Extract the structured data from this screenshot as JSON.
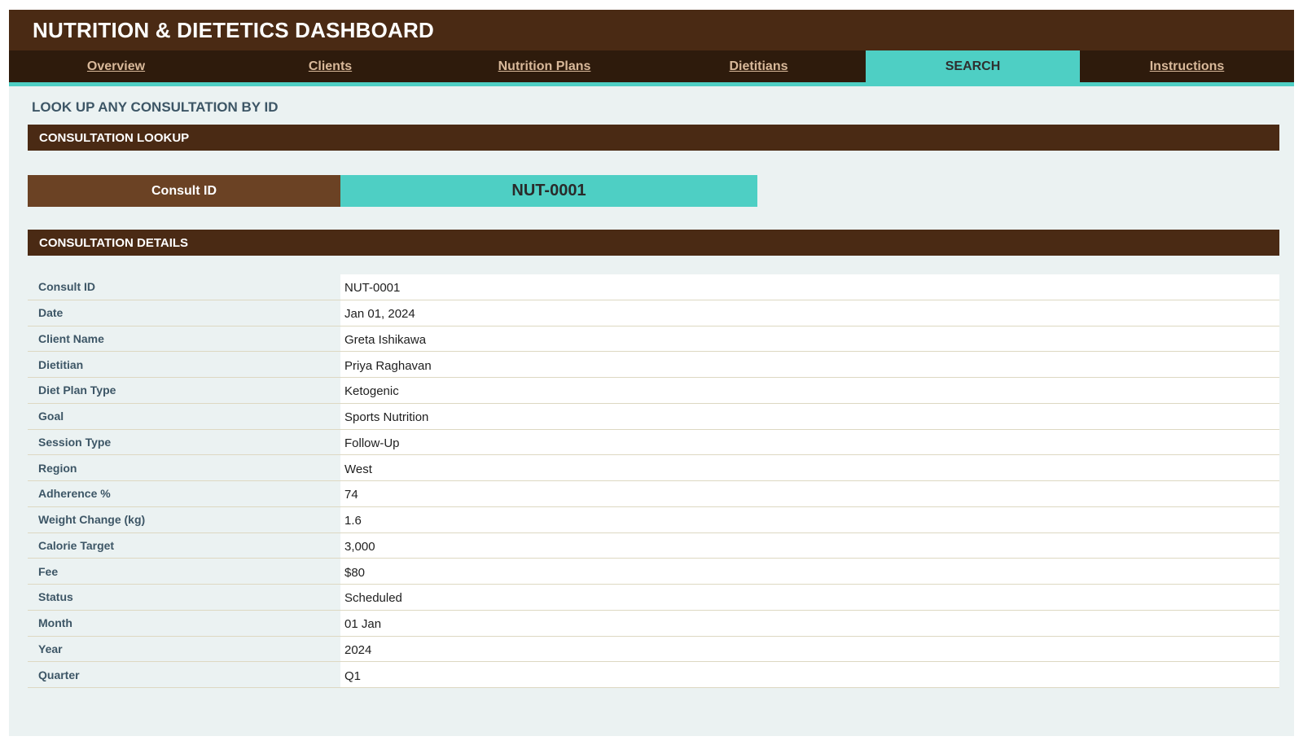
{
  "app": {
    "title": "NUTRITION & DIETETICS DASHBOARD"
  },
  "nav": {
    "tabs": [
      {
        "label": "Overview"
      },
      {
        "label": "Clients"
      },
      {
        "label": "Nutrition Plans"
      },
      {
        "label": "Dietitians"
      },
      {
        "label": "SEARCH"
      },
      {
        "label": "Instructions"
      }
    ],
    "active": "SEARCH"
  },
  "page": {
    "heading": "LOOK UP ANY CONSULTATION BY ID"
  },
  "lookup": {
    "section_title": "CONSULTATION LOOKUP",
    "label": "Consult ID",
    "value": "NUT-0001"
  },
  "details": {
    "section_title": "CONSULTATION DETAILS",
    "rows": [
      {
        "key": "Consult ID",
        "value": "NUT-0001"
      },
      {
        "key": "Date",
        "value": "Jan 01, 2024"
      },
      {
        "key": "Client Name",
        "value": "Greta Ishikawa"
      },
      {
        "key": "Dietitian",
        "value": "Priya Raghavan"
      },
      {
        "key": "Diet Plan Type",
        "value": "Ketogenic"
      },
      {
        "key": "Goal",
        "value": "Sports Nutrition"
      },
      {
        "key": "Session Type",
        "value": "Follow-Up"
      },
      {
        "key": "Region",
        "value": "West"
      },
      {
        "key": "Adherence %",
        "value": "74"
      },
      {
        "key": "Weight Change (kg)",
        "value": "1.6"
      },
      {
        "key": "Calorie Target",
        "value": "3,000"
      },
      {
        "key": "Fee",
        "value": "$80"
      },
      {
        "key": "Status",
        "value": "Scheduled"
      },
      {
        "key": "Month",
        "value": "01 Jan"
      },
      {
        "key": "Year",
        "value": "2024"
      },
      {
        "key": "Quarter",
        "value": "Q1"
      }
    ]
  },
  "colors": {
    "brand_brown": "#4a2a14",
    "nav_dark": "#2e1b0c",
    "accent_teal": "#4ecfc4",
    "label_brown": "#6b4224",
    "panel_bg": "#ebf2f2"
  }
}
